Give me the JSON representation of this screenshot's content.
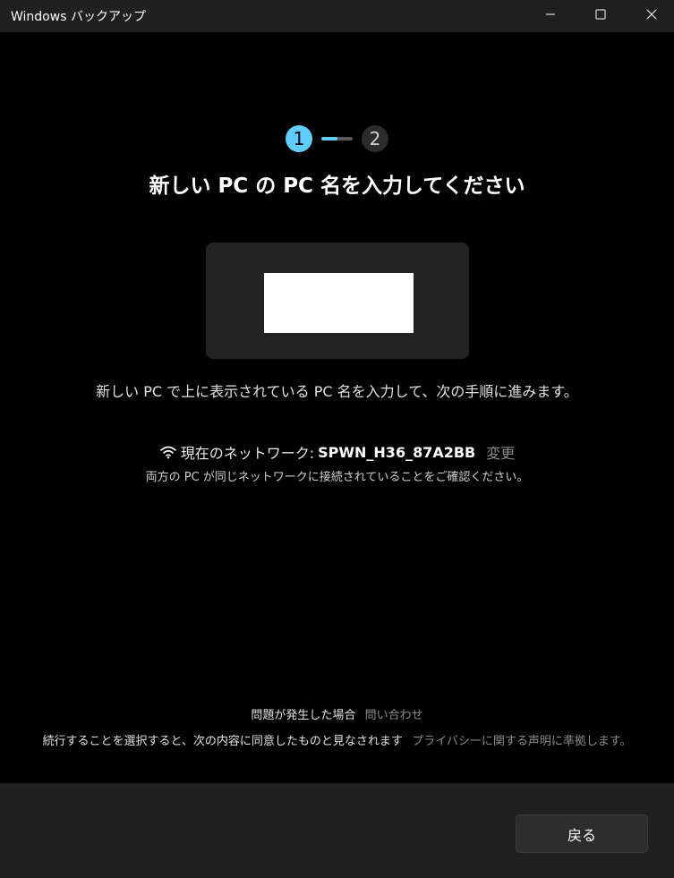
{
  "window": {
    "title": "Windows バックアップ",
    "controls": {
      "minimize_icon": "minimize-icon",
      "maximize_icon": "maximize-icon",
      "close_icon": "close-icon"
    }
  },
  "stepper": {
    "steps": [
      "1",
      "2"
    ],
    "current_step": 1,
    "progress": 0.5,
    "active_color": "#60cdff"
  },
  "main": {
    "heading": "新しい PC の PC 名を入力してください",
    "pc_name_input": {
      "value": "",
      "placeholder": ""
    },
    "instruction": "新しい PC で上に表示されている PC 名を入力して、次の手順に進みます。",
    "network": {
      "icon": "wifi-icon",
      "label": "現在のネットワーク:",
      "ssid": "SPWN_H36_87A2BB",
      "change_link": "変更",
      "note": "両方の PC が同じネットワークに接続されていることをご確認ください。"
    },
    "help": {
      "trouble_text": "問題が発生した場合",
      "contact_link": "問い合わせ",
      "consent_text": "続行することを選択すると、次の内容に同意したものと見なされます",
      "privacy_link": "プライバシーに関する声明に準拠します。"
    }
  },
  "footer": {
    "back_label": "戻る"
  }
}
